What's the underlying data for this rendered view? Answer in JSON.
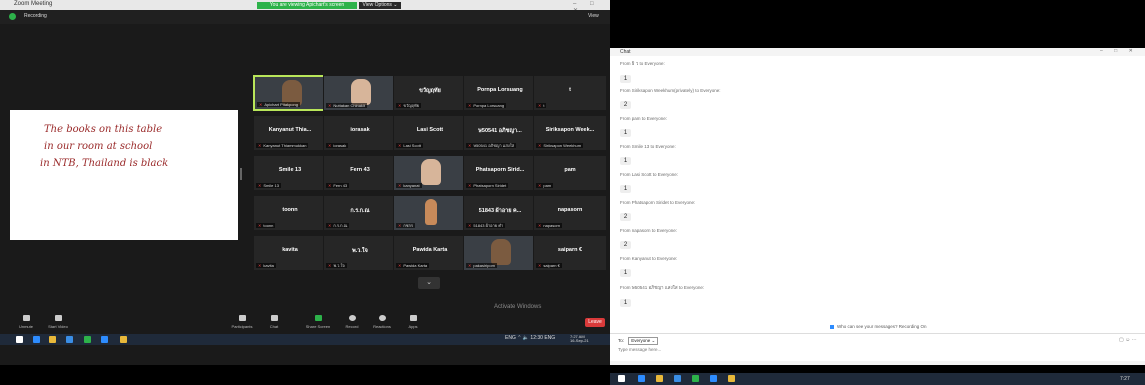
{
  "zoom": {
    "window_title": "Zoom Meeting",
    "banner": "You are viewing Apichart's screen",
    "banner_button": "View Options ⌄",
    "window_controls": "–  □  ✕",
    "topbar_label": "Recording",
    "view_button": "View",
    "shared_screen": {
      "lines": [
        "The books on this table",
        "in our room at school",
        "in NTB, Thailand is black"
      ]
    },
    "participants": [
      {
        "name": "",
        "label": "Apichart Pitakpong",
        "video": true,
        "tone": "dark",
        "speaking": true
      },
      {
        "name": "",
        "label": "Nuttakan Chinakit",
        "video": true,
        "tone": "light"
      },
      {
        "name": "ขวัญฤทัย",
        "label": "ขวัญฤทัย",
        "video": false
      },
      {
        "name": "Pornpa Lorsuang",
        "label": "Pornpa Lorsuang",
        "video": false
      },
      {
        "name": "t",
        "label": "t",
        "video": false
      },
      {
        "name": "Kanyanut Thia...",
        "label": "Kanyanut Thiammukkan",
        "video": false
      },
      {
        "name": "iorasak",
        "label": "iorasak",
        "video": false
      },
      {
        "name": "Lasi Scott",
        "label": "Lasi Scott",
        "video": false
      },
      {
        "name": "ษ50541 อภิชญา...",
        "label": "ษ50541 อภิชญา แสงใส",
        "video": false
      },
      {
        "name": "Siriksapon Week...",
        "label": "Siriksapon Weekhum",
        "video": false
      },
      {
        "name": "Smile 13",
        "label": "Smile 13",
        "video": false
      },
      {
        "name": "Fern 43",
        "label": "Fern 43",
        "video": false
      },
      {
        "name": "",
        "label": "kanyanat",
        "video": true,
        "tone": "light"
      },
      {
        "name": "Phatsaporn Sirid...",
        "label": "Phatsaporn Siridet",
        "video": false
      },
      {
        "name": "pam",
        "label": "pam",
        "video": false
      },
      {
        "name": "toonn",
        "label": "toonn",
        "video": false
      },
      {
        "name": "ก.ร.ก.ณ",
        "label": "ก.ร.ก.ณ",
        "video": false
      },
      {
        "name": "",
        "label": "กชกร",
        "video": true,
        "tone": "doll"
      },
      {
        "name": "51843 ผ้าอาย ค...",
        "label": "51843 ผ้าอาย คำ",
        "video": false
      },
      {
        "name": "napasorn",
        "label": "napasorn",
        "video": false
      },
      {
        "name": "kavita",
        "label": "kavita",
        "video": false
      },
      {
        "name": "พ.ว.ใจ",
        "label": "พ.ว.ใจ",
        "video": false
      },
      {
        "name": "Pawida Karta",
        "label": "Pawida Karta",
        "video": false
      },
      {
        "name": "",
        "label": "pakasiriporn",
        "video": true,
        "tone": "dark"
      },
      {
        "name": "saiparn €",
        "label": "saiparn €",
        "video": false
      }
    ],
    "more_button": "⌄",
    "activation": {
      "title": "Activate Windows",
      "sub": "Go to Settings to activate Windows."
    },
    "controls": {
      "mute": "Unmute",
      "video": "Start Video",
      "participants": "Participants",
      "participants_count": "53",
      "chat": "Chat",
      "share": "Share Screen",
      "record": "Record",
      "reactions": "Reactions",
      "apps": "Apps",
      "end": "Leave"
    },
    "tray_text": "ENG  ⌃  🔈  12:30  ENG",
    "clock": "7:27 AM",
    "date": "16-Sep-21"
  },
  "chat": {
    "title": "Chat",
    "window_controls": "–  □  ✕",
    "messages": [
      {
        "from": "From  ธิ ว  to Everyone:",
        "text": "1"
      },
      {
        "from": "From  Siriksapon Weekhum(privately) to Everyone:",
        "text": "2"
      },
      {
        "from": "From  pam  to Everyone:",
        "text": "1"
      },
      {
        "from": "From  Smile 13 to Everyone:",
        "text": "1"
      },
      {
        "from": "From  Lasi Scott  to Everyone:",
        "text": "1"
      },
      {
        "from": "From  Phatsaporn Siridet  to Everyone:",
        "text": "2"
      },
      {
        "from": "From  napasorn  to Everyone:",
        "text": "2"
      },
      {
        "from": "From  Kanyanut  to Everyone:",
        "text": "1"
      },
      {
        "from": "From  ษ50541 อภิชญา แสงใส  to Everyone:",
        "text": "1"
      }
    ],
    "notice": "Who can see your messages? Recording On",
    "to_label": "To:",
    "to_value": "Everyone ⌄",
    "input_placeholder": "Type message here...",
    "input_icons": "▢  ☺  ···",
    "clock": "7:27"
  }
}
